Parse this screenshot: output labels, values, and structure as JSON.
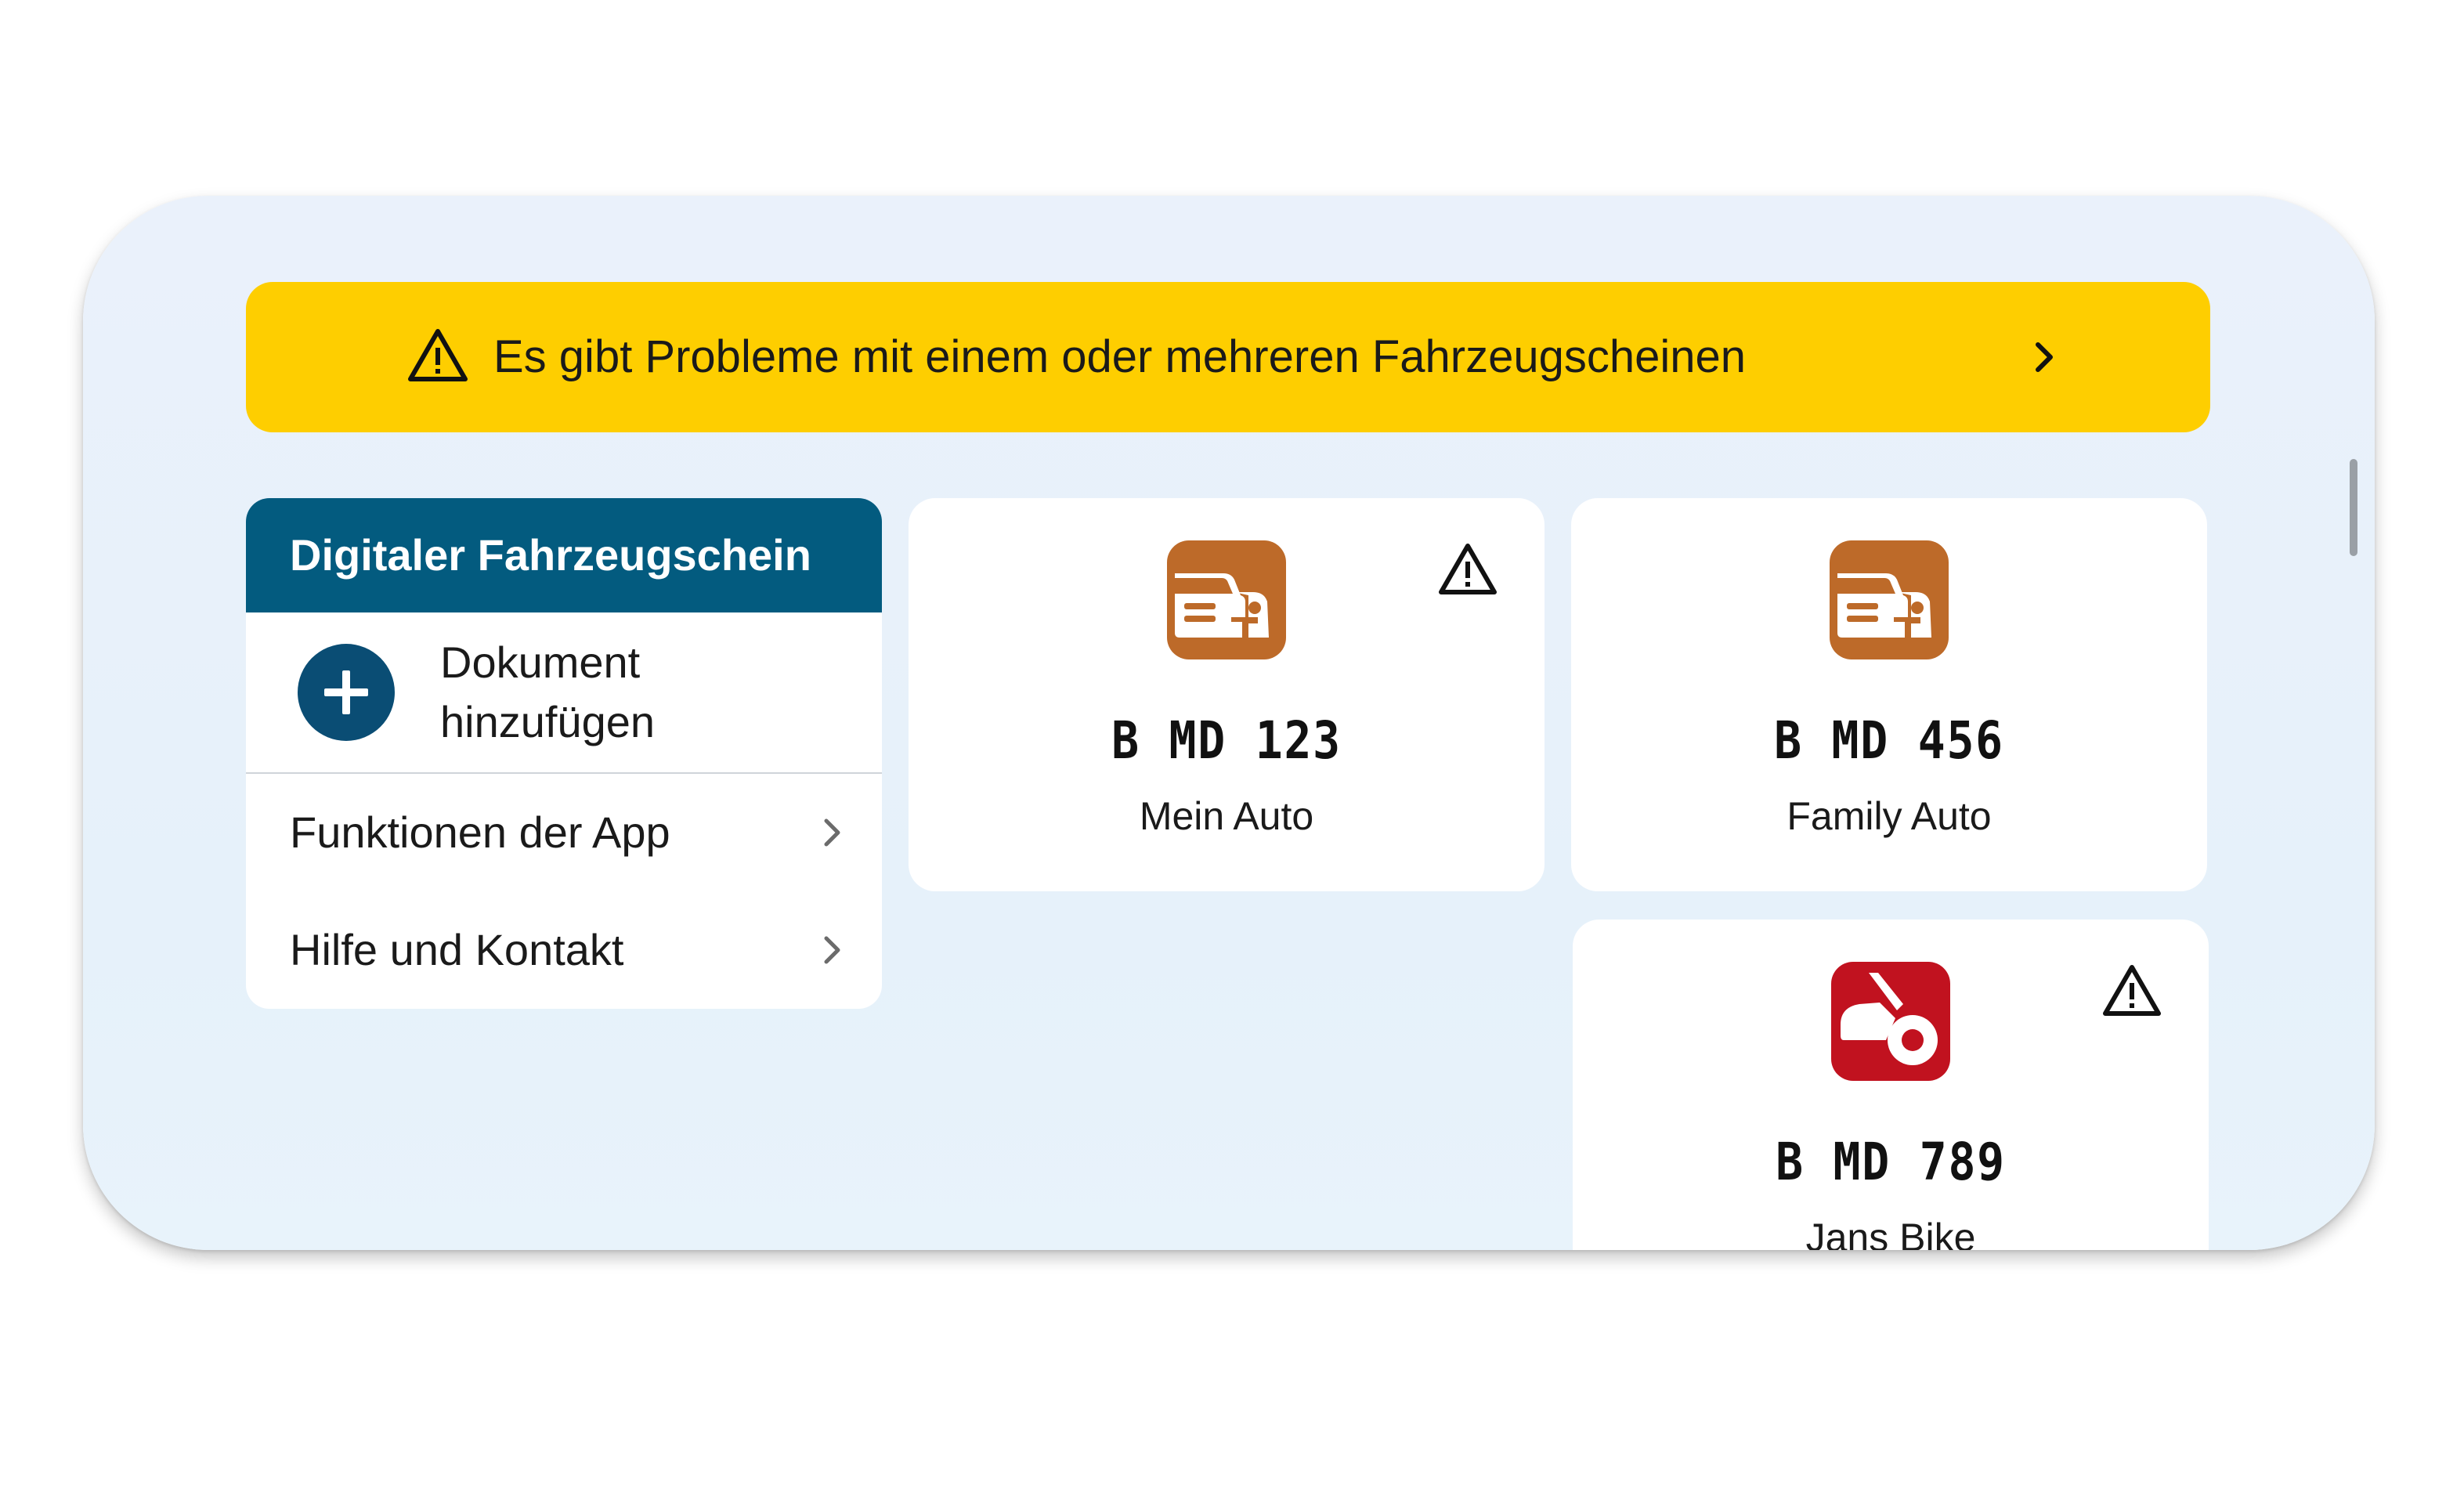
{
  "banner": {
    "text": "Es gibt Probleme mit einem oder mehreren Fahrzeugscheinen",
    "color": "#fece00"
  },
  "sidebar": {
    "title": "Digitaler Fahrzeugschein",
    "header_color": "#035b7f",
    "add_document": {
      "line1": "Dokument",
      "line2": "hinzufügen",
      "icon": "plus-circle-icon"
    },
    "menu": [
      {
        "label": "Funktionen der App",
        "icon": "chevron-right-icon"
      },
      {
        "label": "Hilfe und Kontakt",
        "icon": "chevron-right-icon"
      }
    ]
  },
  "vehicles": [
    {
      "plate": "B MD 123",
      "name": "Mein Auto",
      "type": "car",
      "icon_color": "#bd6a29",
      "has_warning": true
    },
    {
      "plate": "B MD 456",
      "name": "Family Auto",
      "type": "car",
      "icon_color": "#bd6a29",
      "has_warning": false
    },
    {
      "plate": "B MD 789",
      "name": "Jans Bike",
      "type": "motorbike",
      "icon_color": "#c1121f",
      "has_warning": true
    }
  ]
}
